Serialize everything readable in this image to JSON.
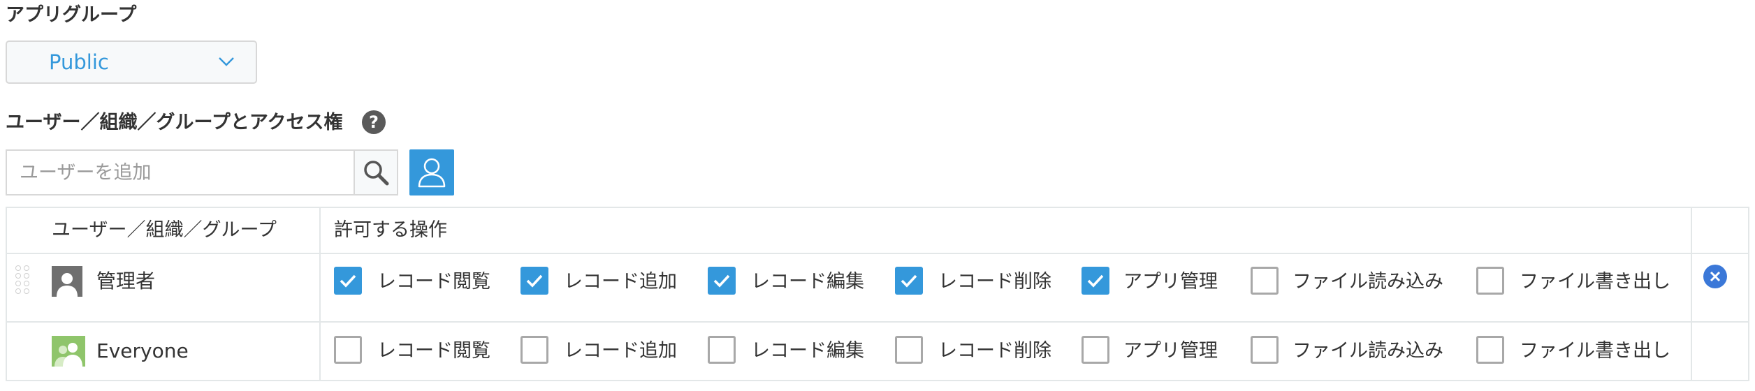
{
  "app_group": {
    "label": "アプリグループ",
    "selected": "Public"
  },
  "access": {
    "label": "ユーザー／組織／グループとアクセス権",
    "help_glyph": "?",
    "search_placeholder": "ユーザーを追加"
  },
  "table": {
    "headers": {
      "entity": "ユーザー／組織／グループ",
      "permissions": "許可する操作"
    },
    "permission_labels": [
      "レコード閲覧",
      "レコード追加",
      "レコード編集",
      "レコード削除",
      "アプリ管理",
      "ファイル読み込み",
      "ファイル書き出し"
    ],
    "rows": [
      {
        "name": "管理者",
        "icon": "user-icon",
        "checked": [
          true,
          true,
          true,
          true,
          true,
          false,
          false
        ]
      },
      {
        "name": "Everyone",
        "icon": "group-icon",
        "checked": [
          false,
          false,
          false,
          false,
          false,
          false,
          false
        ]
      }
    ]
  },
  "colors": {
    "accent": "#3498db",
    "remove": "#3b78d8",
    "everyone_icon": "#8fc56b",
    "admin_icon": "#6f6f6f"
  }
}
